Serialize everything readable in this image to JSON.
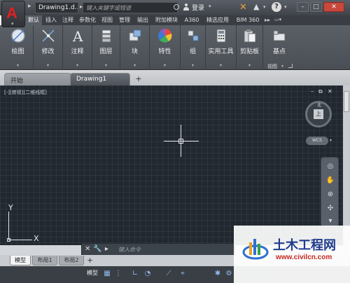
{
  "app": {
    "logo": "A",
    "document_title": "Drawing1.d...",
    "search_placeholder": "键入关键字或短语",
    "login_label": "登录",
    "help_label": "?"
  },
  "ribbon_tabs": [
    "默认",
    "插入",
    "注释",
    "参数化",
    "视图",
    "管理",
    "输出",
    "附加模块",
    "A360",
    "精选应用",
    "BIM 360"
  ],
  "ribbon_active_tab": "默认",
  "ribbon_groups": [
    {
      "label": "绘图",
      "icon": "draw-icon"
    },
    {
      "label": "修改",
      "icon": "modify-icon"
    },
    {
      "label": "注释",
      "icon": "annotation-icon"
    },
    {
      "label": "图层",
      "icon": "layers-icon"
    },
    {
      "label": "块",
      "icon": "block-icon"
    },
    {
      "label": "特性",
      "icon": "properties-icon"
    },
    {
      "label": "组",
      "icon": "group-icon"
    },
    {
      "label": "实用工具",
      "icon": "utilities-icon"
    },
    {
      "label": "剪贴板",
      "icon": "clipboard-icon"
    },
    {
      "label": "基点",
      "icon": "basepoint-icon"
    }
  ],
  "view_panel_label": "视图",
  "file_tabs": {
    "start": "开始",
    "drawing": "Drawing1",
    "add": "+"
  },
  "viewport": {
    "label": "[-][俯视][二维线框]",
    "viewcube_face": "上",
    "viewcube_north": "北",
    "wcs": "WCS"
  },
  "ucs": {
    "x": "X",
    "y": "Y"
  },
  "command_line": {
    "prompt": "键入命令"
  },
  "layout_tabs": {
    "model": "模型",
    "layout1": "布局1",
    "layout2": "布局2",
    "add": "+"
  },
  "status_bar": {
    "model_label": "模型"
  },
  "watermark": {
    "title": "土木工程网",
    "url": "www.civilcn.com"
  },
  "colors": {
    "accent_red": "#e02020",
    "canvas_bg": "#212830",
    "ribbon_bg": "#5b6067",
    "watermark_blue": "#1f3b8f"
  }
}
